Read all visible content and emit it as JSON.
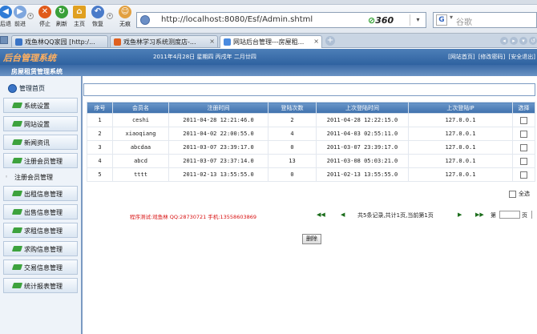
{
  "browser": {
    "toolbar_buttons": [
      {
        "icon": "back-arrow-icon",
        "label": "后退",
        "color": "#2e7bd6"
      },
      {
        "icon": "forward-arrow-icon",
        "label": "前进",
        "color": "#2e7bd6"
      },
      {
        "icon": "stop-icon",
        "label": "停止",
        "color": "#e05a1a"
      },
      {
        "icon": "refresh-icon",
        "label": "刷新",
        "color": "#3aa03a"
      },
      {
        "icon": "home-icon",
        "label": "主页",
        "color": "#e0a020"
      },
      {
        "icon": "undo-icon",
        "label": "恢复",
        "color": "#4a7bc9"
      },
      {
        "icon": "traceless-icon",
        "label": "无痕",
        "color": "#e2a040"
      }
    ],
    "address": "http://localhost:8080/Esf/Admin.shtml",
    "address_brand": "360",
    "search_placeholder": "谷歌",
    "search_engine": "G",
    "tabs": [
      {
        "title": "戏鱼林QQ家园 [http:/...",
        "favicon": "#3a74c6",
        "active": false
      },
      {
        "title": "戏鱼林学习系统测度店-...",
        "favicon": "#e06020",
        "active": false
      },
      {
        "title": "网站后台管理---房屋租...",
        "favicon": "#4a8be0",
        "active": true
      }
    ]
  },
  "app": {
    "logo": "后台管理系统",
    "date_line": "2011年4月28日  星期四  丙戌年  二月廿四",
    "links": [
      "[网站首页]",
      "[修改密码]",
      "[安全退出]"
    ],
    "system_title": "房屋租赁管理系统"
  },
  "sidebar": {
    "home": "管理首页",
    "items": [
      {
        "label": "系统设置",
        "style": "button"
      },
      {
        "label": "网站设置",
        "style": "button"
      },
      {
        "label": "新闻资讯",
        "style": "button"
      },
      {
        "label": "注册会员管理",
        "style": "button"
      },
      {
        "label": "注册会员管理",
        "style": "plain"
      },
      {
        "label": "出租信息管理",
        "style": "button"
      },
      {
        "label": "出售信息管理",
        "style": "button"
      },
      {
        "label": "求租信息管理",
        "style": "button"
      },
      {
        "label": "求购信息管理",
        "style": "button"
      },
      {
        "label": "交易信息管理",
        "style": "button"
      },
      {
        "label": "统计报表管理",
        "style": "button"
      }
    ]
  },
  "table": {
    "headers": [
      "序号",
      "会员名",
      "注册时间",
      "登陆次数",
      "上次登陆时间",
      "上次登陆IP",
      "选择"
    ],
    "rows": [
      [
        "1",
        "ceshi",
        "2011-04-28 12:21:46.0",
        "2",
        "2011-04-28 12:22:15.0",
        "127.0.0.1"
      ],
      [
        "2",
        "xiaoqiang",
        "2011-04-02 22:00:55.0",
        "4",
        "2011-04-03 02:55:11.0",
        "127.0.0.1"
      ],
      [
        "3",
        "abcdaa",
        "2011-03-07 23:39:17.0",
        "0",
        "2011-03-07 23:39:17.0",
        "127.0.0.1"
      ],
      [
        "4",
        "abcd",
        "2011-03-07 23:37:14.0",
        "13",
        "2011-03-08 05:03:21.0",
        "127.0.0.1"
      ],
      [
        "5",
        "tttt",
        "2011-02-13 13:55:55.0",
        "0",
        "2011-02-13 13:55:55.0",
        "127.0.0.1"
      ]
    ],
    "select_all": "全选"
  },
  "footer": {
    "note": "程序测试:戏鱼林 QQ:28730721 手机:13558603869",
    "pager": {
      "first": "◀◀",
      "prev": "◀",
      "info": "共5条记录,共计1页,当前第1页",
      "next": "▶",
      "last": "▶▶",
      "go_label": "第",
      "unit": "页"
    },
    "delete_label": "删除"
  }
}
